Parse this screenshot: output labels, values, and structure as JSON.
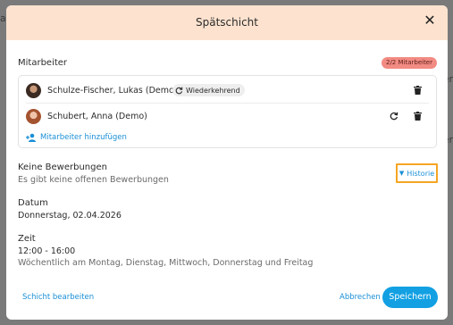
{
  "background": {
    "left_fragment": "ag",
    "right_fragment": "er",
    "right_fragment_2": "er"
  },
  "modal": {
    "title": "Spätschicht",
    "close_icon": "close-icon"
  },
  "staff": {
    "label": "Mitarbeiter",
    "count_badge": "2/2 Mitarbeiter",
    "members": [
      {
        "name": "Schulze-Fischer, Lukas (Demo)",
        "tag": "Wiederkehrend",
        "actions": [
          "trash-icon"
        ]
      },
      {
        "name": "Schubert, Anna (Demo)",
        "actions": [
          "refresh-icon",
          "trash-icon"
        ]
      }
    ],
    "add_label": "Mitarbeiter hinzufügen"
  },
  "applications": {
    "title": "Keine Bewerbungen",
    "subtitle": "Es gibt keine offenen Bewerbungen",
    "history_label": "Historie"
  },
  "date": {
    "label": "Datum",
    "value": "Donnerstag, 02.04.2026"
  },
  "time": {
    "label": "Zeit",
    "value": "12:00 - 16:00",
    "recurrence": "Wöchentlich am Montag, Dienstag, Mittwoch, Donnerstag und Freitag"
  },
  "footer": {
    "edit_label": "Schicht bearbeiten",
    "cancel_label": "Abbrechen",
    "save_label": "Speichern"
  },
  "colors": {
    "header_bg": "#fde3cf",
    "accent": "#12a0e3",
    "link": "#1a8fd6",
    "badge_bg": "#f28b83",
    "highlight_border": "#f5a623"
  }
}
